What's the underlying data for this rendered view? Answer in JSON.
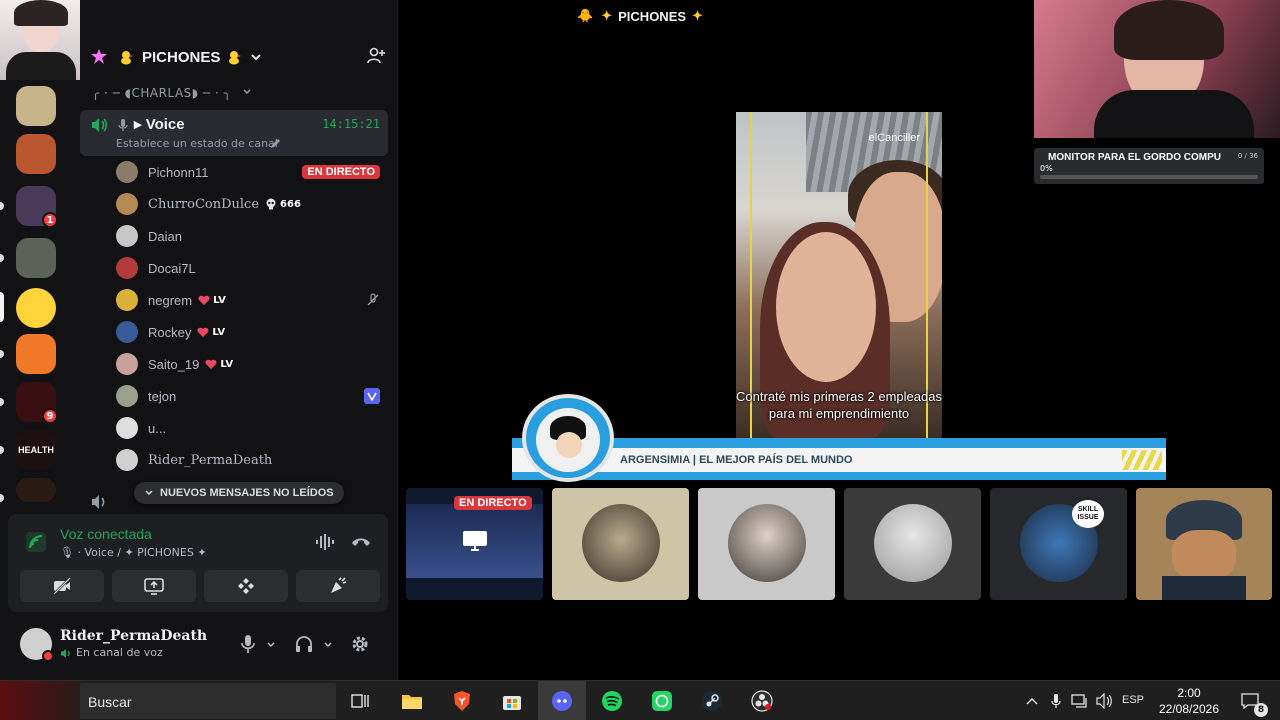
{
  "stage": {
    "title": "PICHONES"
  },
  "server": {
    "name": "PICHONES",
    "category": "CHARLAS"
  },
  "voice_channel": {
    "name": "Voice",
    "timer": "14:15:21",
    "status_placeholder": "Establece un estado de canal"
  },
  "members": [
    {
      "name": "Pichonn11",
      "tag": "",
      "live": "EN DIRECTO",
      "color": "#8a7b6a"
    },
    {
      "name": "ChurroConDulce",
      "tag": "666",
      "live": "",
      "color": "#b58a52"
    },
    {
      "name": "Daian",
      "tag": "",
      "live": "",
      "color": "#c7c7c7"
    },
    {
      "name": "Docai7L",
      "tag": "",
      "live": "",
      "color": "#b33a3a"
    },
    {
      "name": "negrem",
      "tag": "LV",
      "live": "",
      "color": "#d9b038"
    },
    {
      "name": "Rockey",
      "tag": "LV",
      "live": "",
      "color": "#3a5b9a"
    },
    {
      "name": "Saito_19",
      "tag": "LV",
      "live": "",
      "color": "#c9a09a"
    },
    {
      "name": "tejon",
      "tag": "",
      "live": "",
      "color": "#9aa08a"
    },
    {
      "name": "u...",
      "tag": "",
      "live": "",
      "color": "#dedede"
    },
    {
      "name": "Rider_PermaDeath",
      "tag": "",
      "live": "",
      "color": "#cfcfcf"
    }
  ],
  "unread_banner": "NUEVOS MENSAJES NO LEÍDOS",
  "voice_panel": {
    "connected": "Voz conectada",
    "location_channel": "Voice",
    "location_server": "PICHONES"
  },
  "user": {
    "name": "Rider_PermaDeath",
    "status": "En canal de voz"
  },
  "video": {
    "watermark": "elCanciller",
    "caption": "Contraté mis primeras 2 empleadas para mi emprendimiento"
  },
  "ticker": {
    "text": "ARGENSIMIA | EL MEJOR PAÍS DEL MUNDO"
  },
  "tiles": {
    "live_badge": "EN DIRECTO",
    "skill_issue": "SKILL ISSUE"
  },
  "goal": {
    "title": "MONITOR PARA EL GORDO COMPU",
    "percent": "0%",
    "count": "0 / 36",
    "progress": 0
  },
  "server_badges": {
    "a": "1",
    "b": "9"
  },
  "health_label": "HEALTH",
  "taskbar": {
    "search": "Buscar",
    "lang": "ESP",
    "time": "2:00",
    "date": "22/08/2026",
    "notifications": "8"
  },
  "colors": {
    "accent_green": "#23a55a",
    "live_red": "#da373c",
    "ticker_blue": "#2a9fe0"
  }
}
